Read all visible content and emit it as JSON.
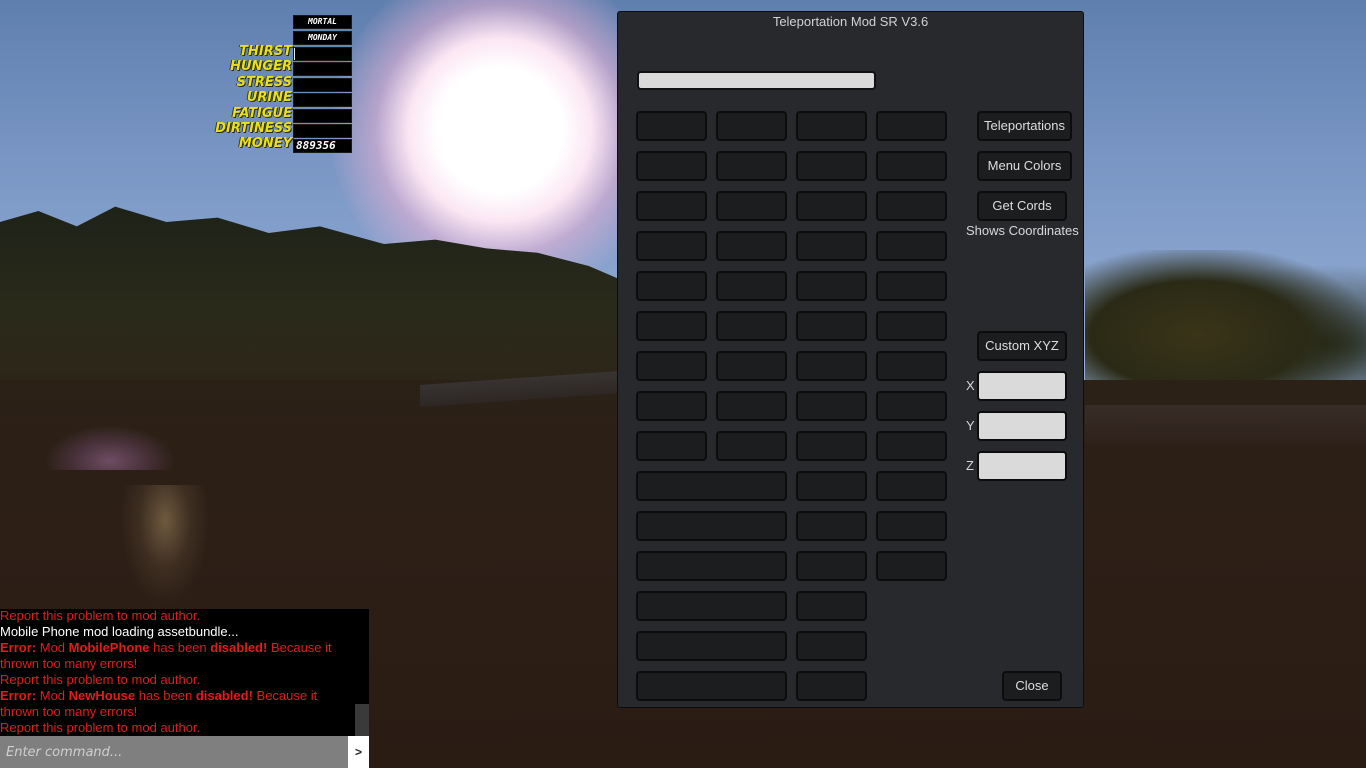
{
  "hud": {
    "mode": "MORTAL",
    "day": "MONDAY",
    "stats": [
      {
        "label": "THIRST",
        "fill": 0.02
      },
      {
        "label": "HUNGER",
        "fill": 0.0
      },
      {
        "label": "STRESS",
        "fill": 0.0
      },
      {
        "label": "URINE",
        "fill": 0.0
      },
      {
        "label": "FATIGUE",
        "fill": 0.0
      },
      {
        "label": "DIRTINESS",
        "fill": 0.0
      }
    ],
    "money_label": "MONEY",
    "money_value": "889356"
  },
  "console": {
    "lines": [
      {
        "type": "error",
        "html": "Report this problem to mod author."
      },
      {
        "type": "info",
        "html": "Mobile Phone mod loading assetbundle..."
      },
      {
        "type": "error",
        "html": "<b>Error:</b> Mod <b>MobilePhone</b> has been <b>disabled!</b> Because it thrown too many errors!"
      },
      {
        "type": "error",
        "html": "Report this problem to mod author."
      },
      {
        "type": "error",
        "html": "<b>Error:</b> Mod <b>NewHouse</b> has been <b>disabled!</b> Because it thrown too many errors!"
      },
      {
        "type": "error",
        "html": "Report this problem to mod author."
      }
    ],
    "input_placeholder": "Enter command...",
    "input_value": "",
    "send_label": ">"
  },
  "mod_window": {
    "title": "Teleportation Mod SR V3.6",
    "search_value": "",
    "grid": {
      "rows": [
        [
          "s",
          "s",
          "s",
          "s"
        ],
        [
          "s",
          "s",
          "s",
          "s"
        ],
        [
          "s",
          "s",
          "s",
          "s"
        ],
        [
          "s",
          "s",
          "s",
          "s"
        ],
        [
          "s",
          "s",
          "s",
          "s"
        ],
        [
          "s",
          "s",
          "s",
          "s"
        ],
        [
          "s",
          "s",
          "s",
          "s"
        ],
        [
          "s",
          "s",
          "s",
          "s"
        ],
        [
          "s",
          "s",
          "s",
          "s"
        ],
        [
          "w",
          "s",
          "s"
        ],
        [
          "w",
          "s",
          "s"
        ],
        [
          "w",
          "s",
          "s"
        ],
        [
          "w",
          "s"
        ],
        [
          "w",
          "s"
        ],
        [
          "w",
          "s"
        ]
      ]
    },
    "buttons": {
      "teleportations": "Teleportations",
      "menu_colors": "Menu Colors",
      "get_cords": "Get Cords",
      "get_cords_hint": "Shows Coordinates",
      "custom_xyz": "Custom XYZ",
      "close": "Close"
    },
    "coords": {
      "x_label": "X",
      "y_label": "Y",
      "z_label": "Z",
      "x_value": "",
      "y_value": "",
      "z_value": ""
    }
  }
}
